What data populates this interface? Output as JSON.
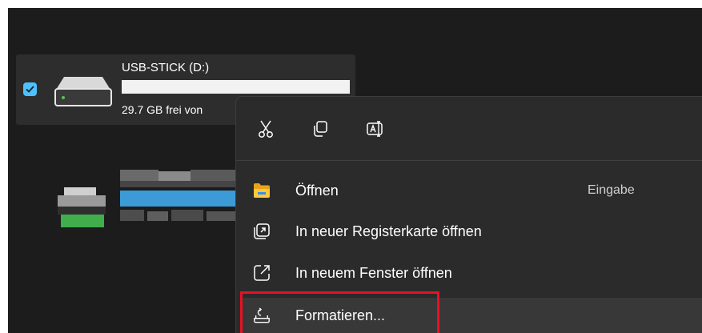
{
  "drive": {
    "name": "USB-STICK (D:)",
    "free_text": "29.7 GB frei von",
    "selected": true,
    "icon": "drive-icon"
  },
  "context_menu": {
    "toolbar": [
      {
        "name": "cut",
        "icon": "scissors-icon"
      },
      {
        "name": "copy",
        "icon": "copy-icon"
      },
      {
        "name": "rename",
        "icon": "rename-icon"
      }
    ],
    "items": [
      {
        "label": "Öffnen",
        "shortcut": "Eingabe",
        "icon": "folder-icon"
      },
      {
        "label": "In neuer Registerkarte öffnen",
        "icon": "new-tab-icon"
      },
      {
        "label": "In neuem Fenster öffnen",
        "icon": "new-window-icon"
      },
      {
        "label": "Formatieren...",
        "icon": "format-icon"
      }
    ]
  },
  "colors": {
    "background": "#1c1c1c",
    "accent": "#4cc2ff",
    "highlight": "#e81123",
    "folder": "#ffc83d"
  }
}
